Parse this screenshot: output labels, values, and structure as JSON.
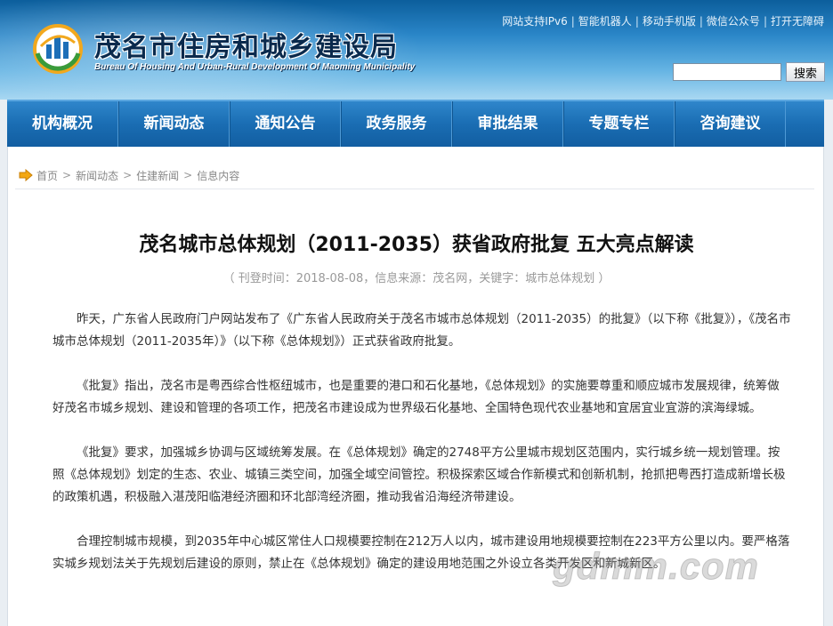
{
  "header": {
    "title": "茂名市住房和城乡建设局",
    "subtitle": "Bureau Of Housing And Urban-Rural Development Of Maoming Municipality",
    "logo_icon": "city-emblem-icon",
    "top_links": [
      "网站支持IPv6",
      "智能机器人",
      "移动手机版",
      "微信公众号",
      "打开无障碍"
    ],
    "search_placeholder": "",
    "search_button": "搜索"
  },
  "nav": {
    "items": [
      "机构概况",
      "新闻动态",
      "通知公告",
      "政务服务",
      "审批结果",
      "专题专栏",
      "咨询建议"
    ]
  },
  "breadcrumb": {
    "icon": "arrow-right-icon",
    "items": [
      "首页",
      "新闻动态",
      "住建新闻",
      "信息内容"
    ]
  },
  "article": {
    "title": "茂名城市总体规划（2011-2035）获省政府批复 五大亮点解读",
    "meta": "（ 刊登时间：2018-08-08，信息来源：茂名网，关键字：城市总体规划 ）",
    "paragraphs": [
      "昨天，广东省人民政府门户网站发布了《广东省人民政府关于茂名市城市总体规划（2011-2035）的批复》（以下称《批复》），《茂名市城市总体规划（2011-2035年）》（以下称《总体规划》）正式获省政府批复。",
      "《批复》指出，茂名市是粤西综合性枢纽城市，也是重要的港口和石化基地，《总体规划》的实施要尊重和顺应城市发展规律，统筹做好茂名市城乡规划、建设和管理的各项工作，把茂名市建设成为世界级石化基地、全国特色现代农业基地和宜居宜业宜游的滨海绿城。",
      "《批复》要求，加强城乡协调与区域统筹发展。在《总体规划》确定的2748平方公里城市规划区范围内，实行城乡统一规划管理。按照《总体规划》划定的生态、农业、城镇三类空间，加强全域空间管控。积极探索区域合作新模式和创新机制，抢抓把粤西打造成新增长极的政策机遇，积极融入湛茂阳临港经济圈和环北部湾经济圈，推动我省沿海经济带建设。",
      "合理控制城市规模，到2035年中心城区常住人口规模要控制在212万人以内，城市建设用地规模要控制在223平方公里以内。要严格落实城乡规划法关于先规划后建设的原则，禁止在《总体规划》确定的建设用地范围之外设立各类开发区和新城新区。"
    ]
  },
  "watermark": "gdmm.com",
  "colors": {
    "nav_bg": "#1a6db3",
    "header_top": "#0c5e9c",
    "title_text": "#0a2a4d"
  }
}
